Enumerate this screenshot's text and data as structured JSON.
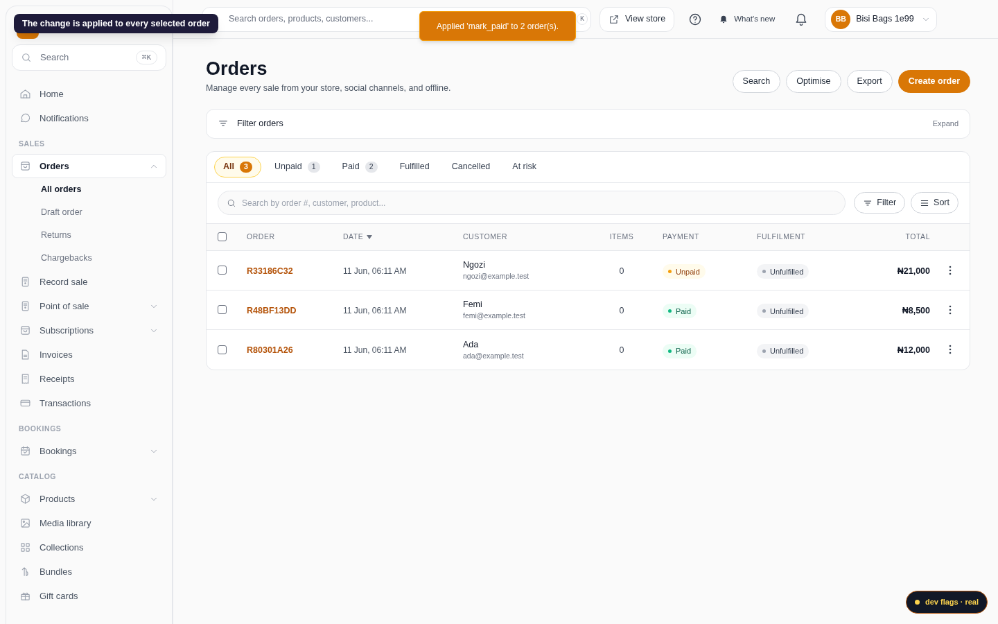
{
  "tooltip": "The change is applied to every selected order",
  "toast": "Applied 'mark_paid' to 2 order(s).",
  "sidebar": {
    "search": {
      "placeholder": "Search",
      "shortcut": "⌘K"
    },
    "items": [
      {
        "kind": "item",
        "label": "Home",
        "selected": false
      },
      {
        "kind": "item",
        "label": "Notifications",
        "selected": false
      },
      {
        "kind": "section",
        "label": "SALES"
      },
      {
        "kind": "item",
        "label": "Orders",
        "selected": true,
        "expandable": true,
        "expanded": true,
        "children": [
          {
            "label": "All orders",
            "selected": true
          },
          {
            "label": "Draft order",
            "selected": false
          },
          {
            "label": "Returns",
            "selected": false
          },
          {
            "label": "Chargebacks",
            "selected": false
          }
        ]
      },
      {
        "kind": "item",
        "label": "Record sale",
        "selected": false
      },
      {
        "kind": "item",
        "label": "Point of sale",
        "selected": false,
        "expandable": true,
        "expanded": false
      },
      {
        "kind": "item",
        "label": "Subscriptions",
        "selected": false,
        "expandable": true,
        "expanded": false
      },
      {
        "kind": "item",
        "label": "Invoices",
        "selected": false
      },
      {
        "kind": "item",
        "label": "Receipts",
        "selected": false
      },
      {
        "kind": "item",
        "label": "Transactions",
        "selected": false
      },
      {
        "kind": "section",
        "label": "BOOKINGS"
      },
      {
        "kind": "item",
        "label": "Bookings",
        "selected": false,
        "expandable": true,
        "expanded": false
      },
      {
        "kind": "section",
        "label": "CATALOG"
      },
      {
        "kind": "item",
        "label": "Products",
        "selected": false,
        "expandable": true,
        "expanded": false
      },
      {
        "kind": "item",
        "label": "Media library",
        "selected": false
      },
      {
        "kind": "item",
        "label": "Collections",
        "selected": false
      },
      {
        "kind": "item",
        "label": "Bundles",
        "selected": false
      },
      {
        "kind": "item",
        "label": "Gift cards",
        "selected": false
      }
    ]
  },
  "topbar": {
    "search": {
      "placeholder": "Search orders, products, customers...",
      "shortcut": "K"
    },
    "view_store": "View store",
    "whats_new": "What's new",
    "account": {
      "initials": "BB",
      "name": "Bisi Bags 1e99"
    }
  },
  "page": {
    "title": "Orders",
    "subtitle": "Manage every sale from your store, social channels, and offline.",
    "actions": [
      {
        "label": "Search",
        "kind": "secondary"
      },
      {
        "label": "Optimise",
        "kind": "secondary"
      },
      {
        "label": "Export",
        "kind": "secondary"
      },
      {
        "label": "Create order",
        "kind": "primary"
      }
    ],
    "filter": {
      "label": "Filter orders",
      "toggle": "Expand"
    }
  },
  "tabs": [
    {
      "label": "All",
      "count": "3",
      "selected": true
    },
    {
      "label": "Unpaid",
      "count": "1",
      "selected": false
    },
    {
      "label": "Paid",
      "count": "2",
      "selected": false
    },
    {
      "label": "Fulfilled",
      "selected": false
    },
    {
      "label": "Cancelled",
      "selected": false
    },
    {
      "label": "At risk",
      "selected": false
    }
  ],
  "table_search": {
    "placeholder": "Search by order #, customer, product..."
  },
  "table_tools": [
    "Filter",
    "Sort"
  ],
  "table": {
    "select_all": false,
    "columns": [
      {
        "label": "ORDER",
        "sorted": false
      },
      {
        "label": "DATE",
        "sorted": true
      },
      {
        "label": "CUSTOMER",
        "sorted": false
      },
      {
        "label": "ITEMS",
        "sorted": false
      },
      {
        "label": "PAYMENT",
        "sorted": false
      },
      {
        "label": "FULFILMENT",
        "sorted": false
      },
      {
        "label": "TOTAL",
        "sorted": false
      }
    ],
    "rows": [
      {
        "checked": false,
        "order": "R33186C32",
        "date": "11 Jun, 06:11 AM",
        "customer": "Ngozi",
        "email": "ngozi@example.test",
        "items": "0",
        "payment": {
          "label": "Unpaid",
          "kind": "unpaid"
        },
        "fulfilment": {
          "label": "Unfulfilled",
          "kind": "unfulfilled"
        },
        "total": "₦21,000"
      },
      {
        "checked": false,
        "order": "R48BF13DD",
        "date": "11 Jun, 06:11 AM",
        "customer": "Femi",
        "email": "femi@example.test",
        "items": "0",
        "payment": {
          "label": "Paid",
          "kind": "paid"
        },
        "fulfilment": {
          "label": "Unfulfilled",
          "kind": "unfulfilled"
        },
        "total": "₦8,500"
      },
      {
        "checked": false,
        "order": "R80301A26",
        "date": "11 Jun, 06:11 AM",
        "customer": "Ada",
        "email": "ada@example.test",
        "items": "0",
        "payment": {
          "label": "Paid",
          "kind": "paid"
        },
        "fulfilment": {
          "label": "Unfulfilled",
          "kind": "unfulfilled"
        },
        "total": "₦12,000"
      }
    ]
  },
  "dev_badge": "dev flags · real"
}
